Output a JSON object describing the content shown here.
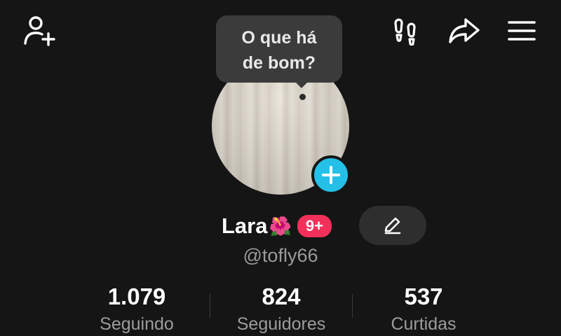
{
  "header": {
    "add_friend_icon": "person-add-icon",
    "footprints_icon": "footprints-icon",
    "share_icon": "share-arrow-icon",
    "menu_icon": "hamburger-menu-icon"
  },
  "bubble": {
    "line1": "O que há",
    "line2": "de bom?"
  },
  "profile": {
    "name": "Lara",
    "name_emoji": "🌺",
    "notification_badge": "9+",
    "handle": "@tofly66",
    "avatar_add_icon": "plus-icon",
    "edit_icon": "pencil-icon"
  },
  "stats": [
    {
      "value": "1.079",
      "label": "Seguindo"
    },
    {
      "value": "824",
      "label": "Seguidores"
    },
    {
      "value": "537",
      "label": "Curtidas"
    }
  ],
  "colors": {
    "background": "#151515",
    "bubble": "#3b3b3b",
    "accent_blue": "#24c0e8",
    "badge_red": "#f2305a",
    "muted_text": "#9a9a9a"
  }
}
